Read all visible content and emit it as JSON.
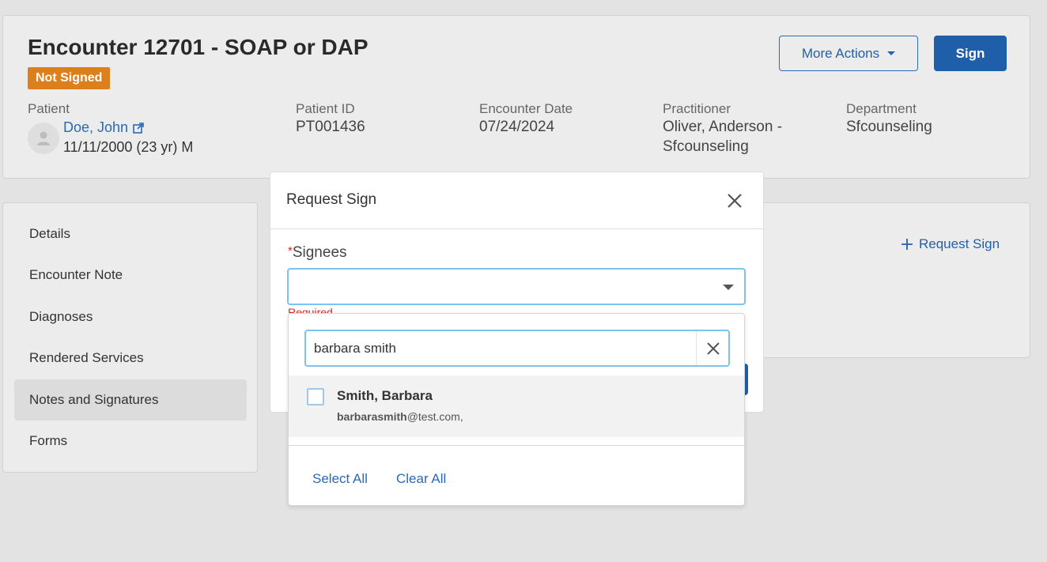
{
  "encounter": {
    "title": "Encounter 12701 - SOAP or DAP",
    "status": "Not Signed",
    "more_actions_label": "More Actions",
    "sign_label": "Sign",
    "colors": {
      "status_badge": "#dd7f1b",
      "primary": "#1f5ea8",
      "link": "#2a6ab5"
    }
  },
  "patient": {
    "label": "Patient",
    "name": "Doe, John",
    "dob_line": "11/11/2000 (23 yr) M"
  },
  "fields": {
    "patient_id_label": "Patient ID",
    "patient_id": "PT001436",
    "encounter_date_label": "Encounter Date",
    "encounter_date": "07/24/2024",
    "practitioner_label": "Practitioner",
    "practitioner_line1": "Oliver, Anderson -",
    "practitioner_line2": "Sfcounseling",
    "department_label": "Department",
    "department": "Sfcounseling"
  },
  "sidebar": {
    "items": [
      {
        "label": "Details"
      },
      {
        "label": "Encounter Note"
      },
      {
        "label": "Diagnoses"
      },
      {
        "label": "Rendered Services"
      },
      {
        "label": "Notes and Signatures",
        "active": true
      },
      {
        "label": "Forms"
      }
    ]
  },
  "main": {
    "request_sign_label": "Request Sign"
  },
  "modal": {
    "title": "Request Sign",
    "signees_label": "Signees",
    "required_marker": "*",
    "required_text": "Required"
  },
  "dropdown": {
    "search_value": "barbara smith",
    "options": [
      {
        "name_bold": "Smith",
        "name_rest": ", Barbara",
        "email_bold": "barbarasmith",
        "email_rest": "@test.com,",
        "checked": false
      }
    ],
    "select_all_label": "Select All",
    "clear_all_label": "Clear All"
  }
}
